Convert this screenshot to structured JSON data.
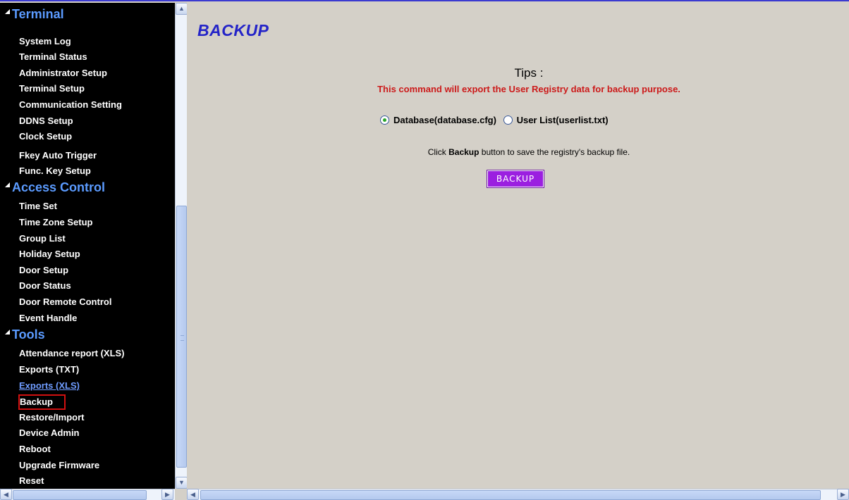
{
  "nav": {
    "sections": [
      {
        "title": "Terminal",
        "items": [
          "System Log",
          "Terminal Status",
          "Administrator Setup",
          "Terminal Setup",
          "Communication Setting",
          "DDNS Setup",
          "Clock Setup",
          "Fkey Auto Trigger",
          "Func. Key Setup"
        ]
      },
      {
        "title": "Access Control",
        "items": [
          "Time Set",
          "Time Zone Setup",
          "Group List",
          "Holiday Setup",
          "Door Setup",
          "Door Status",
          "Door Remote Control",
          "Event Handle"
        ]
      },
      {
        "title": "Tools",
        "items": [
          "Attendance report (XLS)",
          "Exports (TXT)",
          "Exports (XLS)",
          "Backup",
          "Restore/Import",
          "Device Admin",
          "Reboot",
          "Upgrade Firmware",
          "Reset"
        ]
      }
    ],
    "selected_item": "Backup",
    "visited_link": "Exports (XLS)"
  },
  "main": {
    "title": "BACKUP",
    "tips_heading": "Tips :",
    "tips_text": "This command will export the User Registry data for backup purpose.",
    "options": [
      {
        "label": "Database(database.cfg)",
        "checked": true
      },
      {
        "label": "User List(userlist.txt)",
        "checked": false
      }
    ],
    "instruction_pre": "Click ",
    "instruction_bold": "Backup",
    "instruction_post": " button to save the registry's backup file.",
    "backup_button": "BACKUP"
  },
  "colors": {
    "nav_background": "#000000",
    "nav_header": "#5b9bff",
    "title": "#2424c8",
    "tips_text": "#cc1a1a",
    "button": "#9b1fe0",
    "selection_box": "#d01010"
  }
}
